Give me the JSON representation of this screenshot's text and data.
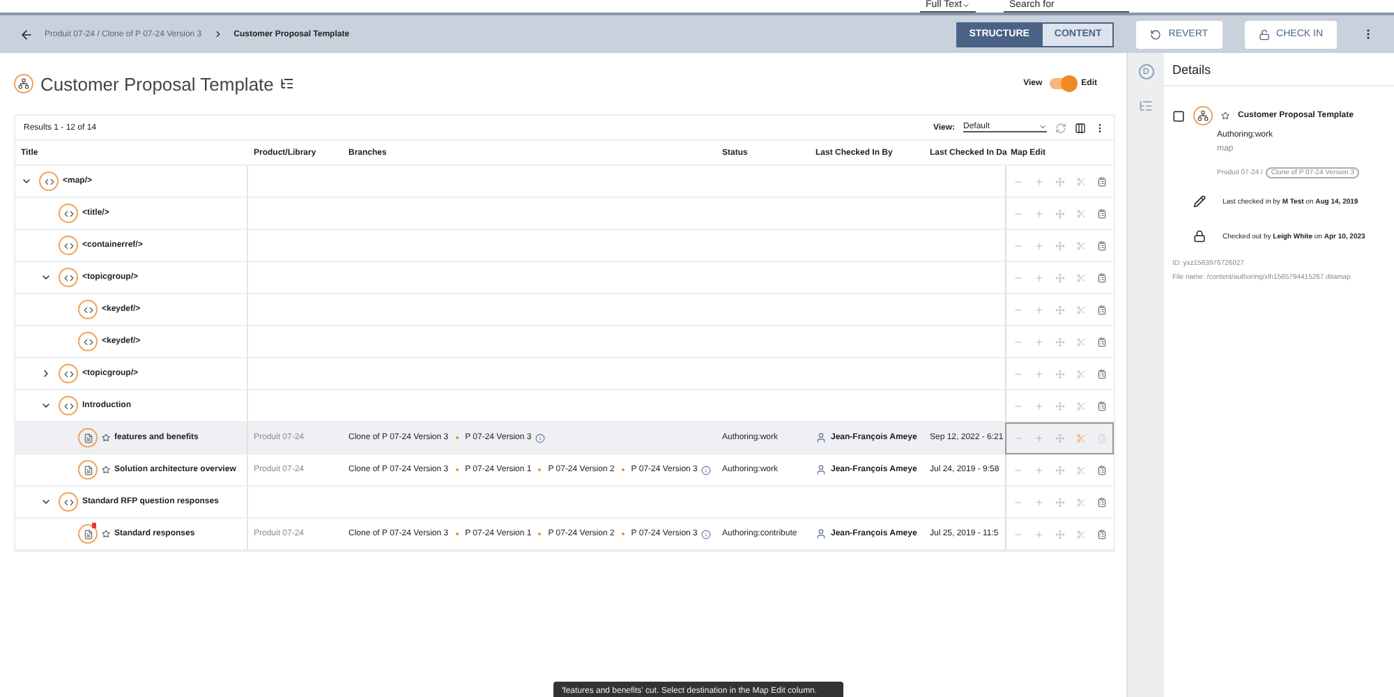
{
  "top_bar": {
    "search_scope": "Full Text",
    "search_placeholder": "Search for"
  },
  "breadcrumb": {
    "path": "Produit 07-24 / Clone of P 07-24 Version 3",
    "current": "Customer Proposal Template"
  },
  "mode_tabs": [
    {
      "label": "STRUCTURE",
      "selected": true
    },
    {
      "label": "CONTENT",
      "selected": false
    }
  ],
  "actions": [
    {
      "label": "REVERT",
      "kind": "revert"
    },
    {
      "label": "CHECK IN",
      "kind": "checkin"
    }
  ],
  "page_title": "Customer Proposal Template",
  "view_toggle": {
    "left": "View",
    "right": "Edit",
    "on": true
  },
  "results": "Results 1 - 12 of 14",
  "view_select": {
    "label": "View:",
    "value": "Default"
  },
  "columns": [
    "Title",
    "Product/Library",
    "Branches",
    "Status",
    "Last Checked In By",
    "Last Checked In Da",
    "Map Edit"
  ],
  "tree": [
    {
      "label": "<map/>",
      "kind": "element",
      "expanded": true,
      "children": [
        {
          "label": "<title/>",
          "kind": "element"
        },
        {
          "label": "<containerref/>",
          "kind": "element"
        },
        {
          "label": "<topicgroup/>",
          "kind": "element",
          "expanded": true,
          "children": [
            {
              "label": "<keydef/>",
              "kind": "element"
            },
            {
              "label": "<keydef/>",
              "kind": "element"
            }
          ]
        },
        {
          "label": "<topicgroup/>",
          "kind": "element",
          "expanded": false
        },
        {
          "label": "Introduction",
          "kind": "element",
          "expanded": true,
          "children": [
            {
              "label": "features and benefits",
              "kind": "topic",
              "selected": true,
              "cut": true,
              "product": "Produit 07-24",
              "branches": [
                "Clone of P 07-24 Version 3",
                "P 07-24 Version 3"
              ],
              "status": "Authoring:work",
              "checked_by": "Jean-François Ameye",
              "checked_date": "Sep 12, 2022 - 6:21"
            },
            {
              "label": "Solution architecture overview",
              "kind": "topic",
              "selected": false,
              "cut": false,
              "product": "Produit 07-24",
              "branches": [
                "Clone of P 07-24 Version 3",
                "P 07-24 Version 1",
                "P 07-24 Version 2",
                "P 07-24 Version 3"
              ],
              "status": "Authoring:work",
              "checked_by": "Jean-François Ameye",
              "checked_date": "Jul 24, 2019 - 9:58"
            }
          ]
        },
        {
          "label": "Standard RFP question responses",
          "kind": "element",
          "expanded": true,
          "children": [
            {
              "label": "Standard responses",
              "kind": "topic",
              "selected": false,
              "cut": false,
              "flagged": true,
              "product": "Produit 07-24",
              "branches": [
                "Clone of P 07-24 Version 3",
                "P 07-24 Version 1",
                "P 07-24 Version 2",
                "P 07-24 Version 3"
              ],
              "status": "Authoring:contribute",
              "checked_by": "Jean-François Ameye",
              "checked_date": "Jul 25, 2019 - 11:5"
            }
          ]
        }
      ]
    }
  ],
  "details": {
    "title": "Details",
    "rail_letter": "D",
    "checked": false,
    "item": "Customer Proposal Template",
    "status": "Authoring:work",
    "type": "map",
    "product": "Produit 07-24 /",
    "branch": "Clone of P 07-24 Version 3",
    "checked_in": "Last checked in by **M Test** on **Aug 14, 2019**",
    "checked_out": "Checked out by **Leigh White** on **Apr 10, 2023**",
    "id": "ID: yxz1563976726027",
    "file": "File name: /content/authoring/xlh1565794415267.ditamap"
  },
  "toast": "'features and benefits' cut. Select destination in the Map Edit column."
}
